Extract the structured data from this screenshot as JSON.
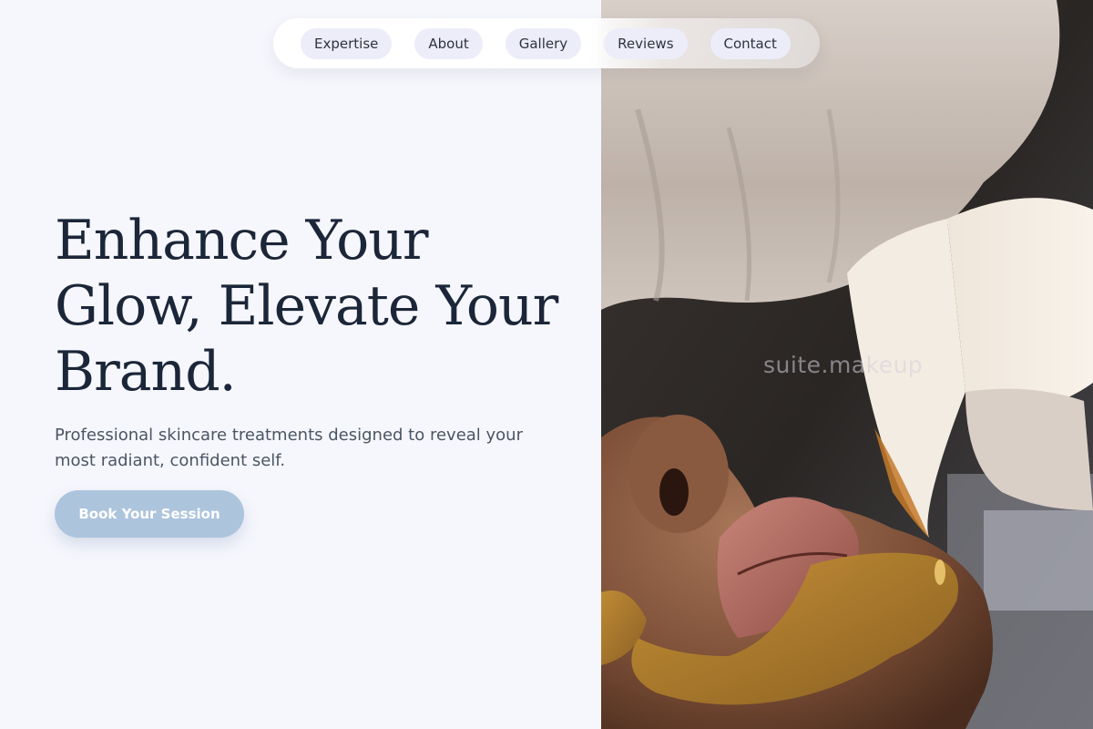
{
  "nav": {
    "items": [
      {
        "label": "Expertise"
      },
      {
        "label": "About"
      },
      {
        "label": "Gallery"
      },
      {
        "label": "Reviews"
      },
      {
        "label": "Contact"
      }
    ]
  },
  "hero": {
    "headline": "Enhance Your Glow, Elevate Your Brand.",
    "subtext": "Professional skincare treatments designed to reveal your most radiant, confident self.",
    "cta_label": "Book Your Session",
    "image_watermark": "suite.makeup"
  },
  "colors": {
    "background": "#f6f7fd",
    "headline": "#1b2638",
    "body_text": "#4b5563",
    "cta_background": "#adc4dd",
    "nav_pill": "#ecedf9"
  }
}
